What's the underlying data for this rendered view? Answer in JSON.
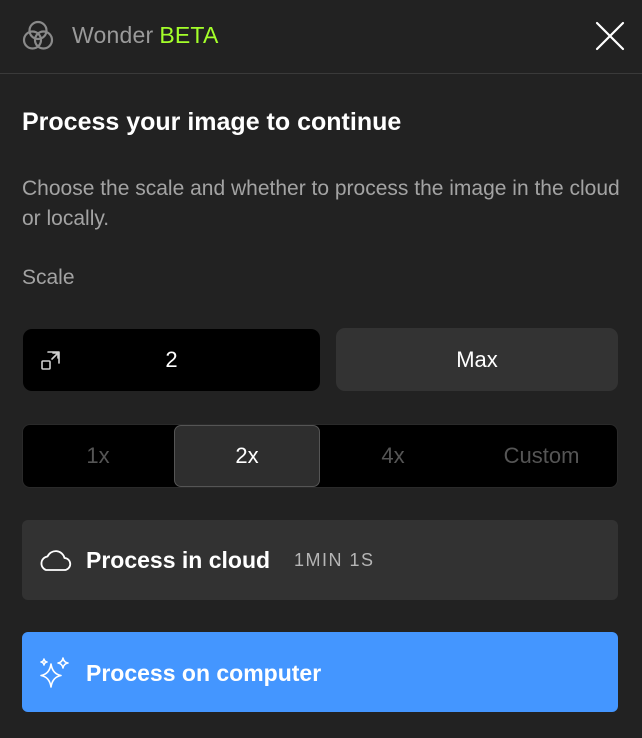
{
  "header": {
    "app_name": "Wonder",
    "badge": "BETA",
    "badge_color": "#a4ff2a",
    "logo_icon": "overlapping-circles-icon",
    "close_icon": "close-icon"
  },
  "main": {
    "title": "Process your image to continue",
    "description": "Choose the scale and whether to process the image in the cloud or locally.",
    "scale_label": "Scale"
  },
  "scale_input": {
    "icon": "resize-icon",
    "value": "2"
  },
  "max_button": {
    "label": "Max"
  },
  "scale_options": {
    "selected": "2x",
    "items": [
      {
        "label": "1x"
      },
      {
        "label": "2x"
      },
      {
        "label": "4x"
      },
      {
        "label": "Custom"
      }
    ]
  },
  "cloud": {
    "icon": "cloud-icon",
    "label": "Process in cloud",
    "eta": "1MIN 1S"
  },
  "computer": {
    "icon": "sparkle-icon",
    "label": "Process on computer",
    "color": "#4496ff"
  }
}
